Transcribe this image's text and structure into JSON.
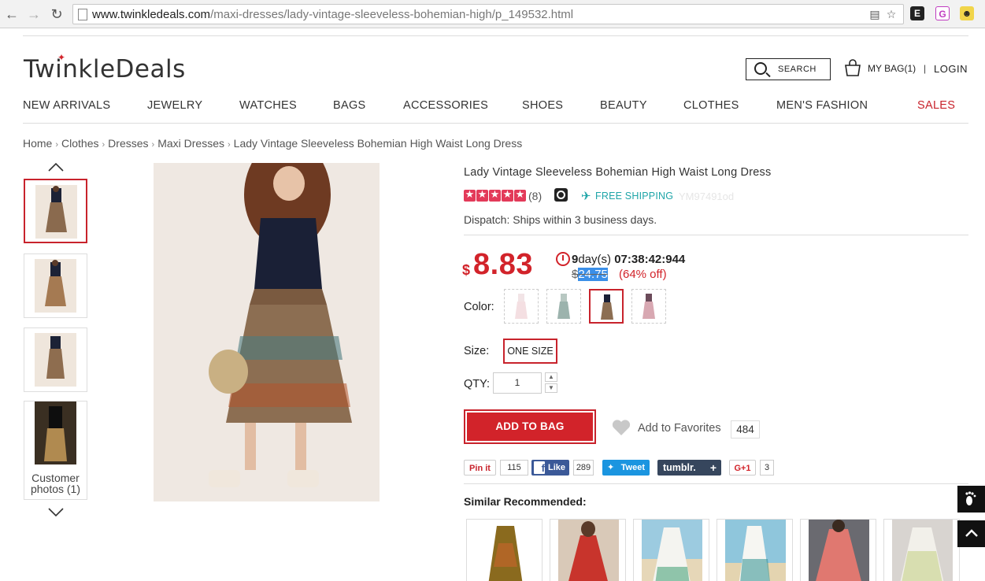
{
  "browser": {
    "back_icon": "back-arrow-icon",
    "forward_icon": "forward-arrow-icon",
    "reload_icon": "reload-icon",
    "url_host": "www.twinkledeals.com",
    "url_path": "/maxi-dresses/lady-vintage-sleeveless-bohemian-high/p_149532.html"
  },
  "header": {
    "logo": "TwinkleDeals",
    "search_label": "SEARCH",
    "bag_label": "MY BAG(1)",
    "separator": "|",
    "login_label": "LOGIN"
  },
  "nav": {
    "items": [
      "NEW ARRIVALS",
      "JEWELRY",
      "WATCHES",
      "BAGS",
      "ACCESSORIES",
      "SHOES",
      "BEAUTY",
      "CLOTHES",
      "MEN'S FASHION",
      "SALES"
    ],
    "highlight_color": "#c8232c"
  },
  "breadcrumb": {
    "items": [
      "Home",
      "Clothes",
      "Dresses",
      "Maxi Dresses",
      "Lady Vintage Sleeveless Bohemian High Waist Long Dress"
    ]
  },
  "gallery": {
    "customer_photos_line1": "Customer",
    "customer_photos_line2": "photos (1)"
  },
  "product": {
    "title": "Lady Vintage Sleeveless Bohemian High Waist Long Dress",
    "rating_stars": 5,
    "review_count": "(8)",
    "free_shipping": "FREE SHIPPING",
    "sku": "YM97491od",
    "dispatch": "Dispatch: Ships within 3 business days.",
    "currency": "$",
    "price": "8.83",
    "countdown_days": "9",
    "countdown_days_label": "day(s)",
    "countdown_time": "07:38:42:944",
    "original_currency": "$",
    "original_price": "24.75",
    "discount": "(64% off)",
    "color_label": "Color:",
    "size_label": "Size:",
    "size_value": "ONE SIZE",
    "qty_label": "QTY:",
    "qty_value": "1",
    "qty_up": "▲",
    "qty_down": "▼",
    "add_to_bag": "ADD TO BAG",
    "favorites_label": "Add to Favorites",
    "favorites_count": "484",
    "accent_color": "#d2232a"
  },
  "share": {
    "pinterest_label": "Pin it",
    "pinterest_count": "115",
    "facebook_label": "Like",
    "facebook_count": "289",
    "twitter_label": "Tweet",
    "tumblr_label": "tumblr.",
    "gplus_label": "G+1",
    "gplus_count": "3"
  },
  "similar": {
    "title": "Similar Recommended:"
  },
  "side": {
    "footprint_icon": "footprint-icon",
    "top_icon": "back-to-top-icon"
  }
}
